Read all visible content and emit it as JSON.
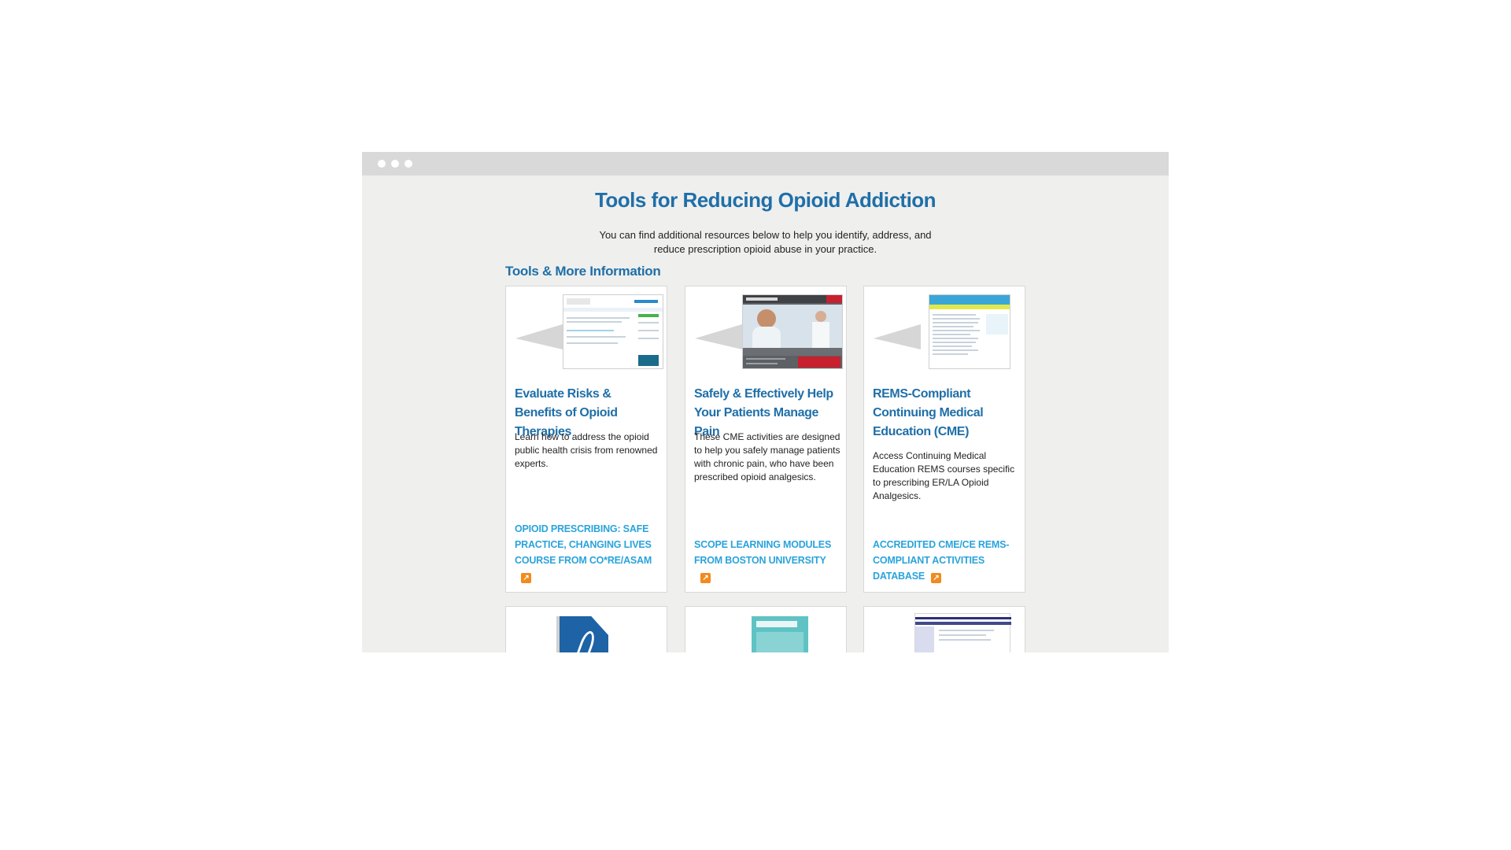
{
  "page": {
    "title": "Tools for Reducing Opioid Addiction",
    "intro": "You can find additional resources below to help you identify, address, and reduce prescription opioid abuse in your practice.",
    "section_title": "Tools & More Information"
  },
  "cards": [
    {
      "title": "Evaluate Risks & Benefits of Opioid Therapies",
      "description": "Learn how to address the opioid public health crisis from renowned experts.",
      "link": "OPIOID PRESCRIBING: SAFE PRACTICE, CHANGING LIVES COURSE FROM CO*RE/ASAM",
      "thumb_icon": "website-screenshot-icon"
    },
    {
      "title": "Safely & Effectively Help Your Patients Manage Pain",
      "description": "These CME activities are designed to help you safely manage patients with chronic pain, who have been prescribed opioid analgesics.",
      "link": "SCOPE LEARNING MODULES FROM BOSTON UNIVERSITY",
      "thumb_icon": "scope-of-pain-screenshot-icon"
    },
    {
      "title": "REMS-Compliant Continuing Medical Education (CME)",
      "description": "Access Continuing Medical Education REMS courses specific to prescribing ER/LA Opioid Analgesics.",
      "link": "ACCREDITED CME/CE REMS-COMPLIANT ACTIVITIES DATABASE",
      "thumb_icon": "rems-document-screenshot-icon"
    }
  ],
  "external_icon_glyph": "↗",
  "colors": {
    "heading": "#1f6fa8",
    "link": "#2aa3db",
    "external_icon": "#f28a1e",
    "window_bg": "#efefee",
    "titlebar": "#d9d9d9"
  }
}
